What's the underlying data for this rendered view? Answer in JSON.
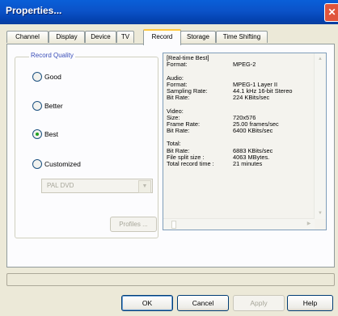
{
  "window": {
    "title": "Properties..."
  },
  "tabs": [
    "Channel",
    "Display",
    "Device",
    "TV",
    "Record",
    "Storage",
    "Time Shifting"
  ],
  "active_tab": "Record",
  "record_quality": {
    "label": "Record Quality",
    "options": [
      "Good",
      "Better",
      "Best",
      "Customized"
    ],
    "selected": "Best",
    "profile_dropdown": "PAL DVD",
    "profiles_button": "Profiles ..."
  },
  "info": {
    "rows": [
      {
        "k": "[Real-time Best]",
        "v": ""
      },
      {
        "k": "Format:",
        "v": "MPEG-2"
      },
      {
        "k": "",
        "v": ""
      },
      {
        "k": "Audio:",
        "v": ""
      },
      {
        "k": "Format:",
        "v": "MPEG-1 Layer II"
      },
      {
        "k": "Sampling Rate:",
        "v": "44.1 kHz 16-bit Stereo"
      },
      {
        "k": "Bit Rate:",
        "v": "224 KBits/sec"
      },
      {
        "k": "",
        "v": ""
      },
      {
        "k": "Video:",
        "v": ""
      },
      {
        "k": "Size:",
        "v": "720x576"
      },
      {
        "k": "Frame Rate:",
        "v": "25.00 frames/sec"
      },
      {
        "k": "Bit Rate:",
        "v": "6400 KBits/sec"
      },
      {
        "k": "",
        "v": ""
      },
      {
        "k": "Total:",
        "v": ""
      },
      {
        "k": "Bit Rate:",
        "v": "6883 KBits/sec"
      },
      {
        "k": "File split size :",
        "v": "4063 MBytes."
      },
      {
        "k": "Total record time :",
        "v": "21 minutes"
      }
    ]
  },
  "buttons": {
    "ok": "OK",
    "cancel": "Cancel",
    "apply": "Apply",
    "help": "Help"
  }
}
